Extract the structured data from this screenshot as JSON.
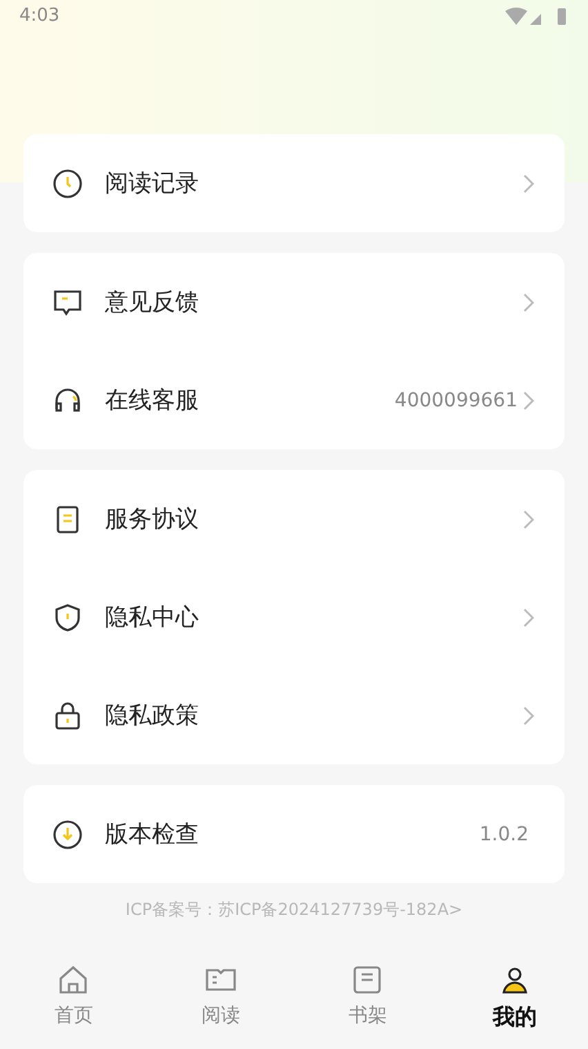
{
  "status_bar": {
    "time": "4:03"
  },
  "groups": [
    {
      "rows": [
        {
          "label": "阅读记录",
          "chevron": true
        }
      ]
    },
    {
      "rows": [
        {
          "label": "意见反馈",
          "chevron": true
        },
        {
          "label": "在线客服",
          "value": "4000099661",
          "chevron": true
        }
      ]
    },
    {
      "rows": [
        {
          "label": "服务协议",
          "chevron": true
        },
        {
          "label": "隐私中心",
          "chevron": true
        },
        {
          "label": "隐私政策",
          "chevron": true
        }
      ]
    },
    {
      "rows": [
        {
          "label": "版本检查",
          "value": "1.0.2",
          "chevron": false
        }
      ]
    }
  ],
  "icp": "ICP备案号：苏ICP备2024127739号-182A>",
  "tabs": [
    {
      "label": "首页",
      "selected": false
    },
    {
      "label": "阅读",
      "selected": false
    },
    {
      "label": "书架",
      "selected": false
    },
    {
      "label": "我的",
      "selected": true
    }
  ]
}
